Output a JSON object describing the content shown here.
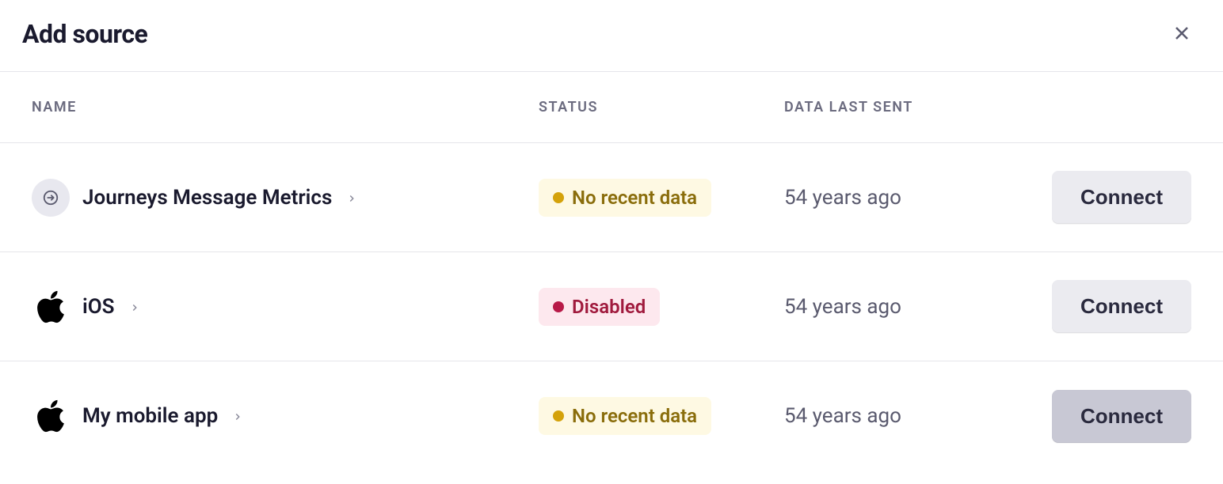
{
  "header": {
    "title": "Add source"
  },
  "columns": {
    "name": "NAME",
    "status": "STATUS",
    "date": "DATA LAST SENT"
  },
  "actions": {
    "connect": "Connect"
  },
  "statuses": {
    "no_recent_data": "No recent data",
    "disabled": "Disabled"
  },
  "sources": [
    {
      "icon": "journeys",
      "name": "Journeys Message Metrics",
      "status_key": "no_recent_data",
      "status_style": "warning",
      "last_sent": "54 years ago",
      "button_state": "normal"
    },
    {
      "icon": "apple",
      "name": "iOS",
      "status_key": "disabled",
      "status_style": "disabled",
      "last_sent": "54 years ago",
      "button_state": "normal"
    },
    {
      "icon": "apple",
      "name": "My mobile app",
      "status_key": "no_recent_data",
      "status_style": "warning",
      "last_sent": "54 years ago",
      "button_state": "pressed"
    }
  ]
}
